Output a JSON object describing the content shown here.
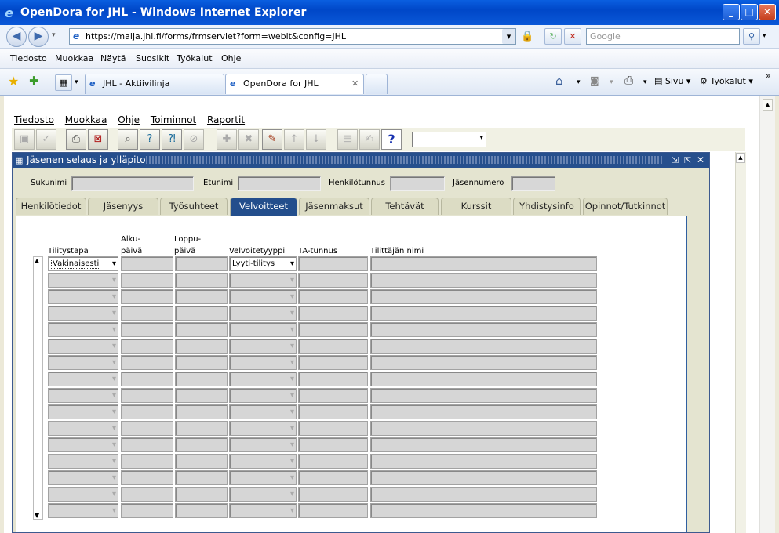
{
  "window": {
    "title": "OpenDora for JHL - Windows Internet Explorer"
  },
  "address": {
    "url": "https://maija.jhl.fi/forms/frmservlet?form=weblt&config=JHL",
    "search_placeholder": "Google"
  },
  "ie_menu": [
    "Tiedosto",
    "Muokkaa",
    "Näytä",
    "Suosikit",
    "Työkalut",
    "Ohje"
  ],
  "browser_tabs": [
    {
      "label": "JHL - Aktiivilinja",
      "active": false
    },
    {
      "label": "OpenDora for JHL",
      "active": true
    }
  ],
  "command_bar": {
    "page": "Sivu",
    "tools": "Työkalut"
  },
  "forms_menu": [
    "Tiedosto",
    "Muokkaa",
    "Ohje",
    "Toiminnot",
    "Raportit"
  ],
  "inner": {
    "title": "Jäsenen selaus ja ylläpito"
  },
  "search_fields": {
    "sukunimi": "Sukunimi",
    "etunimi": "Etunimi",
    "henkilotunnus": "Henkilötunnus",
    "jasennumero": "Jäsennumero"
  },
  "tabs": [
    "Henkilötiedot",
    "Jäsenyys",
    "Työsuhteet",
    "Velvoitteet",
    "Jäsenmaksut",
    "Tehtävät",
    "Kurssit",
    "Yhdistysinfo",
    "Opinnot/Tutkinnot"
  ],
  "selected_tab": "Velvoitteet",
  "columns": {
    "tilitystapa": "Tilitystapa",
    "alku_1": "Alku-",
    "alku_2": "päivä",
    "loppu_1": "Loppu-",
    "loppu_2": "päivä",
    "velvoitetyyppi": "Velvoitetyyppi",
    "ta_tunnus": "TA-tunnus",
    "tilittajan_nimi": "Tilittäjän nimi"
  },
  "first_row": {
    "tilitystapa": "Vakinaisesti",
    "velvoitetyyppi": "Lyyti-tilitys"
  },
  "row_count": 16
}
